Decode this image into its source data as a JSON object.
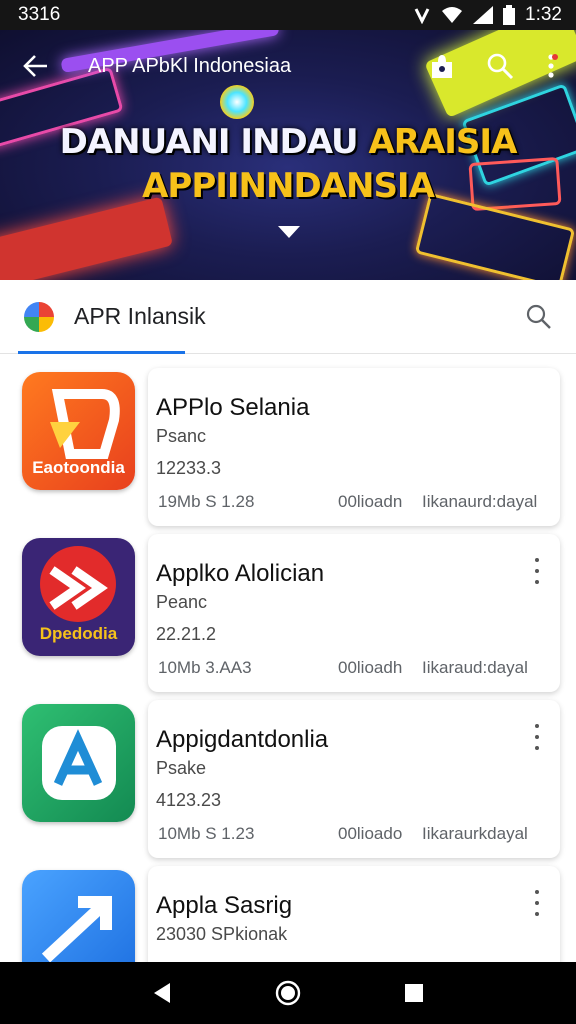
{
  "status_bar": {
    "time_left": "3316",
    "time_right": "1:32"
  },
  "header": {
    "title": "APP  APbKl Indonesiaa",
    "hero_line1_a": "DANUANI INDAU ",
    "hero_line1_b": "ARAISIA",
    "hero_line2": "APPIINNDANSIA"
  },
  "search": {
    "query": "APR Inlansik",
    "accent": "#1a73e8"
  },
  "apps": [
    {
      "name": "APPlo Selania",
      "subtitle": "Psanc",
      "rating": "12233.3",
      "size": "19Mb S 1.28",
      "downloads": "00lioadn",
      "developer": "Iikanaurd:dayal",
      "brand": "Eaotoondia",
      "icon_color": "#f0542a",
      "brand_icon": "d-logo-icon",
      "has_more": false
    },
    {
      "name": "Applko Alolician",
      "subtitle": "Peanc",
      "rating": "22.21.2",
      "size": "10Mb 3.AA3",
      "downloads": "00lioadh",
      "developer": "Iikaraud:dayal",
      "brand": "Dpedodia",
      "icon_color": "#3a2575",
      "brand_icon": "flag-logo-icon",
      "has_more": true
    },
    {
      "name": "Appigdantdonlia",
      "subtitle": "Psake",
      "rating": "4123.23",
      "size": "10Mb S 1.23",
      "downloads": "00lioado",
      "developer": "Iikaraurkdayal",
      "brand": "",
      "icon_color": "#1e9e5f",
      "brand_icon": "a-logo-icon",
      "has_more": true
    },
    {
      "name": "Appla Sasrig",
      "subtitle": "23030  SPkionak",
      "rating": "",
      "size": "",
      "downloads": "",
      "developer": "",
      "brand": "",
      "icon_color": "#2b7be4",
      "brand_icon": "arrow-logo-icon",
      "has_more": true
    }
  ]
}
